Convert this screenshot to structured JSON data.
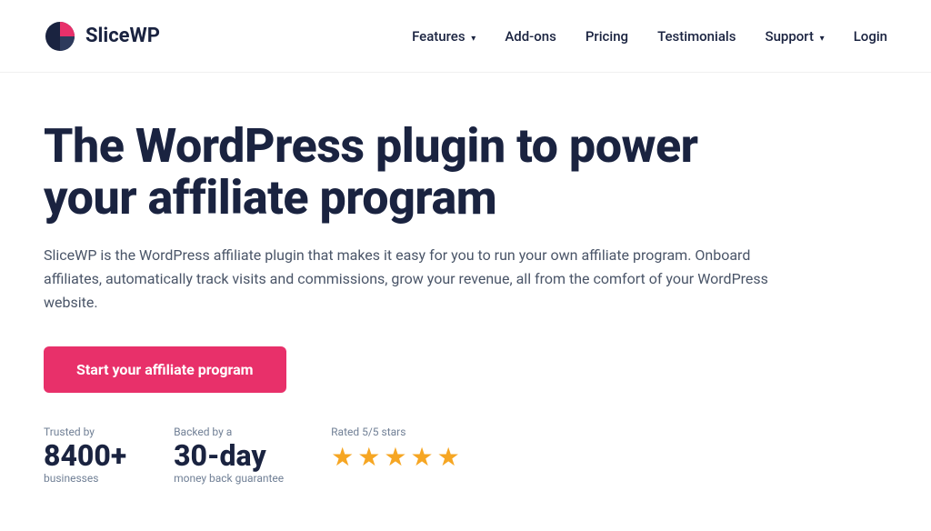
{
  "nav": {
    "logo_text": "SliceWP",
    "links": [
      {
        "label": "Features",
        "has_dropdown": true
      },
      {
        "label": "Add-ons",
        "has_dropdown": false
      },
      {
        "label": "Pricing",
        "has_dropdown": false
      },
      {
        "label": "Testimonials",
        "has_dropdown": false
      },
      {
        "label": "Support",
        "has_dropdown": true
      },
      {
        "label": "Login",
        "has_dropdown": false
      }
    ]
  },
  "hero": {
    "title": "The WordPress plugin to power your affiliate program",
    "description": "SliceWP is the WordPress affiliate plugin that makes it easy for you to run your own affiliate program. Onboard affiliates, automatically track visits and commissions, grow your revenue, all from the comfort of your WordPress website.",
    "cta_label": "Start your affiliate program"
  },
  "social_proof": {
    "trusted": {
      "label": "Trusted by",
      "number": "8400+",
      "sublabel": "businesses"
    },
    "backed": {
      "label": "Backed by a",
      "number": "30-day",
      "sublabel": "money back guarantee"
    },
    "rating": {
      "label": "Rated 5/5 stars",
      "stars": 5
    }
  },
  "colors": {
    "cta": "#e8306a",
    "star": "#f6a623",
    "heading": "#1a2340",
    "body_text": "#4a5568",
    "muted": "#718096"
  }
}
